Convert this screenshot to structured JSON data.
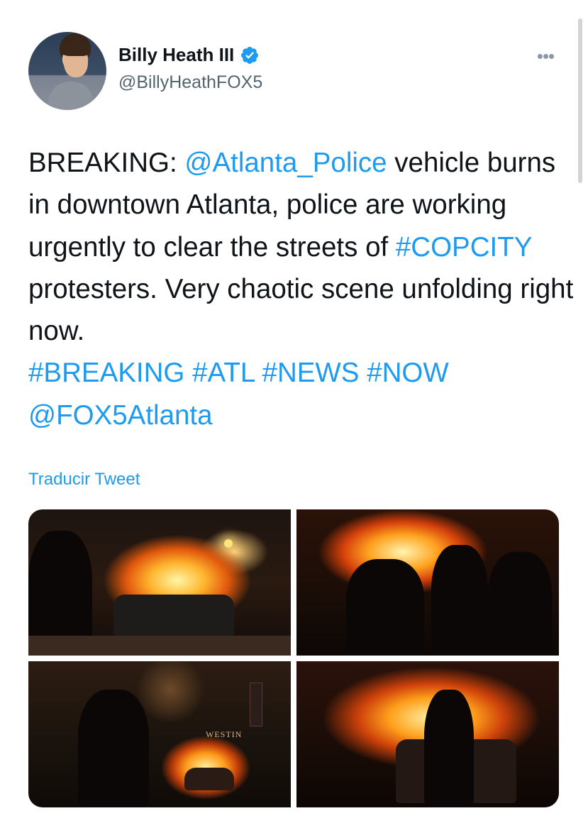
{
  "tweet": {
    "author": {
      "display_name": "Billy Heath III",
      "handle": "@BillyHeathFOX5",
      "verified": true
    },
    "text_segments": [
      {
        "text": "BREAKING: ",
        "type": "text"
      },
      {
        "text": "@Atlanta_Police",
        "type": "mention"
      },
      {
        "text": " vehicle burns in downtown Atlanta, police are working urgently to clear the streets of ",
        "type": "text"
      },
      {
        "text": "#COPCITY",
        "type": "hashtag"
      },
      {
        "text": " protesters. Very chaotic scene unfolding right now.\n",
        "type": "text"
      },
      {
        "text": "#BREAKING",
        "type": "hashtag"
      },
      {
        "text": " ",
        "type": "text"
      },
      {
        "text": "#ATL",
        "type": "hashtag"
      },
      {
        "text": " ",
        "type": "text"
      },
      {
        "text": "#NEWS",
        "type": "hashtag"
      },
      {
        "text": " ",
        "type": "text"
      },
      {
        "text": "#NOW",
        "type": "hashtag"
      },
      {
        "text": "\n",
        "type": "text"
      },
      {
        "text": "@FOX5Atlanta",
        "type": "mention"
      }
    ],
    "translate_label": "Traducir Tweet",
    "media": [
      {
        "name": "photo-burning-police-car"
      },
      {
        "name": "photo-officers-silhouettes"
      },
      {
        "name": "photo-street-fire-westin",
        "sign_text": "WESTIN"
      },
      {
        "name": "photo-officer-near-fire"
      }
    ]
  },
  "icons": {
    "more": "more-options-icon",
    "verified": "verified-badge-icon"
  },
  "colors": {
    "link": "#1d9bf0",
    "text": "#0f1419",
    "secondary": "#536471",
    "verified": "#1d9bf0"
  },
  "more_glyph": "•••"
}
